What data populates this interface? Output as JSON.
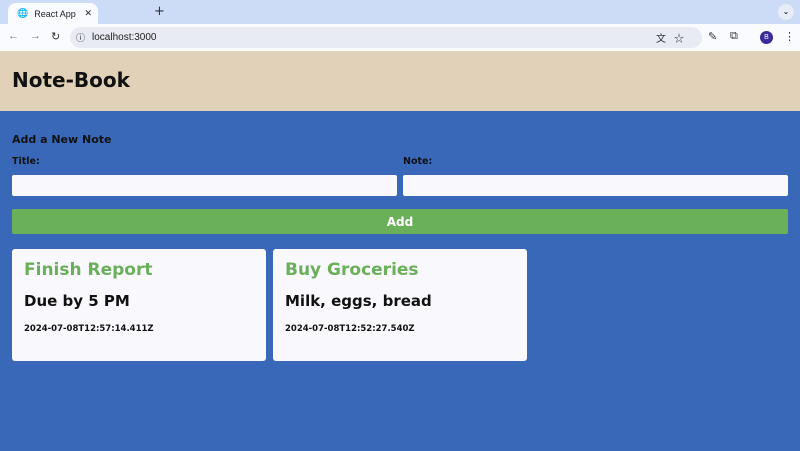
{
  "browser": {
    "tab_title": "React App",
    "url": "localhost:3000",
    "profile_initial": "B"
  },
  "header": {
    "title": "Note-Book"
  },
  "form": {
    "heading": "Add a New Note",
    "title_label": "Title:",
    "note_label": "Note:",
    "title_value": "",
    "note_value": "",
    "add_label": "Add"
  },
  "notes": [
    {
      "title": "Finish Report",
      "content": "Due by 5 PM",
      "timestamp": "2024-07-08T12:57:14.411Z"
    },
    {
      "title": "Buy Groceries",
      "content": "Milk, eggs, bread",
      "timestamp": "2024-07-08T12:52:27.540Z"
    }
  ],
  "colors": {
    "background": "#3a68b8",
    "header": "#e0d1b8",
    "accent": "#6aaf5a"
  }
}
